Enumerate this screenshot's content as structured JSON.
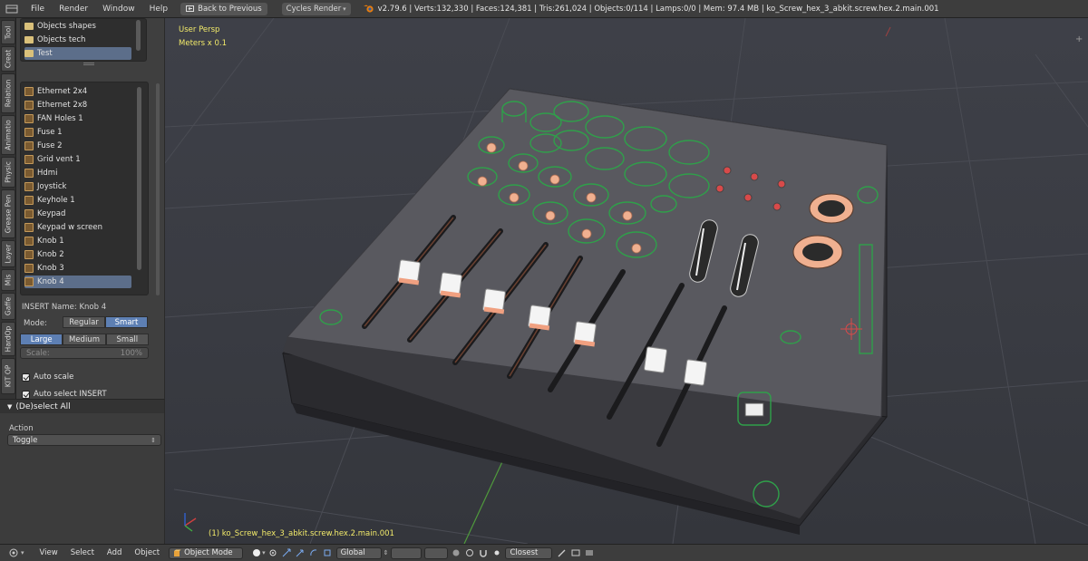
{
  "topbar": {
    "menus": [
      "File",
      "Render",
      "Window",
      "Help"
    ],
    "back_button": "Back to Previous",
    "render_engine": "Cycles Render",
    "stats": "v2.79.6 | Verts:132,330 | Faces:124,381 | Tris:261,024 | Objects:0/114 | Lamps:0/0 | Mem: 97.4 MB | ko_Screw_hex_3_abkit.screw.hex.2.main.001"
  },
  "tool_tabs": [
    "Tool",
    "Creat",
    "Relation",
    "Animatio",
    "Physic",
    "Grease Pen",
    "Layer",
    "Mis",
    "Gaffe",
    "HardOp",
    "KIT OP"
  ],
  "categories": [
    {
      "label": "Objects shapes",
      "selected": false
    },
    {
      "label": "Objects tech",
      "selected": false
    },
    {
      "label": "Test",
      "selected": true
    }
  ],
  "inserts": [
    {
      "label": "Ethernet 2x4",
      "selected": false
    },
    {
      "label": "Ethernet 2x8",
      "selected": false
    },
    {
      "label": "FAN Holes 1",
      "selected": false
    },
    {
      "label": "Fuse 1",
      "selected": false
    },
    {
      "label": "Fuse 2",
      "selected": false
    },
    {
      "label": "Grid vent 1",
      "selected": false
    },
    {
      "label": "Hdmi",
      "selected": false
    },
    {
      "label": "Joystick",
      "selected": false
    },
    {
      "label": "Keyhole 1",
      "selected": false
    },
    {
      "label": "Keypad",
      "selected": false
    },
    {
      "label": "Keypad w screen",
      "selected": false
    },
    {
      "label": "Knob 1",
      "selected": false
    },
    {
      "label": "Knob 2",
      "selected": false
    },
    {
      "label": "Knob 3",
      "selected": false
    },
    {
      "label": "Knob 4",
      "selected": true
    }
  ],
  "insert_name": "INSERT Name: Knob 4",
  "mode": {
    "label": "Mode:",
    "options": [
      "Regular",
      "Smart"
    ],
    "active": "Smart"
  },
  "size": {
    "options": [
      "Large",
      "Medium",
      "Small"
    ],
    "active": "Large"
  },
  "scale": {
    "label": "Scale:",
    "value": "100%"
  },
  "checks": [
    {
      "label": "Auto scale",
      "checked": true
    },
    {
      "label": "Auto select INSERT",
      "checked": true
    }
  ],
  "operator": {
    "title": "(De)select All",
    "action_label": "Action",
    "action_value": "Toggle"
  },
  "viewport": {
    "view_name": "User Persp",
    "units": "Meters x 0.1",
    "object_name": "(1) ko_Screw_hex_3_abkit.screw.hex.2.main.001"
  },
  "bottombar": {
    "menus": [
      "View",
      "Select",
      "Add",
      "Object"
    ],
    "mode": "Object Mode",
    "orientation": "Global",
    "snap": "Closest"
  },
  "colors": {
    "selection": "#5c6e8a",
    "toggle_active": "#5d7fb3",
    "wire_green": "#2fa04a",
    "knob_orange": "#f0b090",
    "header_text": "#f2ea6a"
  }
}
